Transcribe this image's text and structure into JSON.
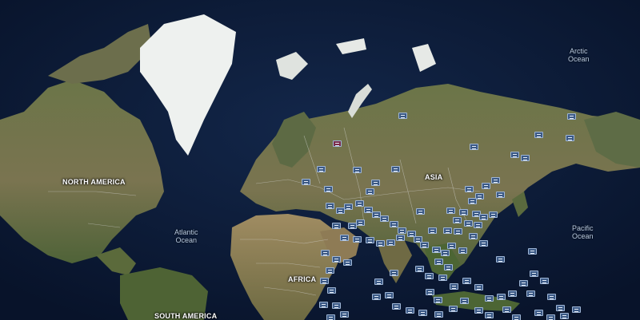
{
  "map": {
    "continents": {
      "north_america": "NORTH AMERICA",
      "asia": "ASIA",
      "africa": "AFRICA",
      "south_america": "SOUTH AMERICA"
    },
    "oceans": {
      "arctic": [
        "Arctic",
        "Ocean"
      ],
      "atlantic": [
        "Atlantic",
        "Ocean"
      ],
      "pacific": [
        "Pacific",
        "Ocean"
      ]
    },
    "colors": {
      "water": "#0b1730",
      "land": "#5c6b3f",
      "ice": "#f2f3f2",
      "border": "#d8d8d8",
      "marker": "#3c5a86"
    },
    "marker_icon": "camera-marker-icon"
  }
}
